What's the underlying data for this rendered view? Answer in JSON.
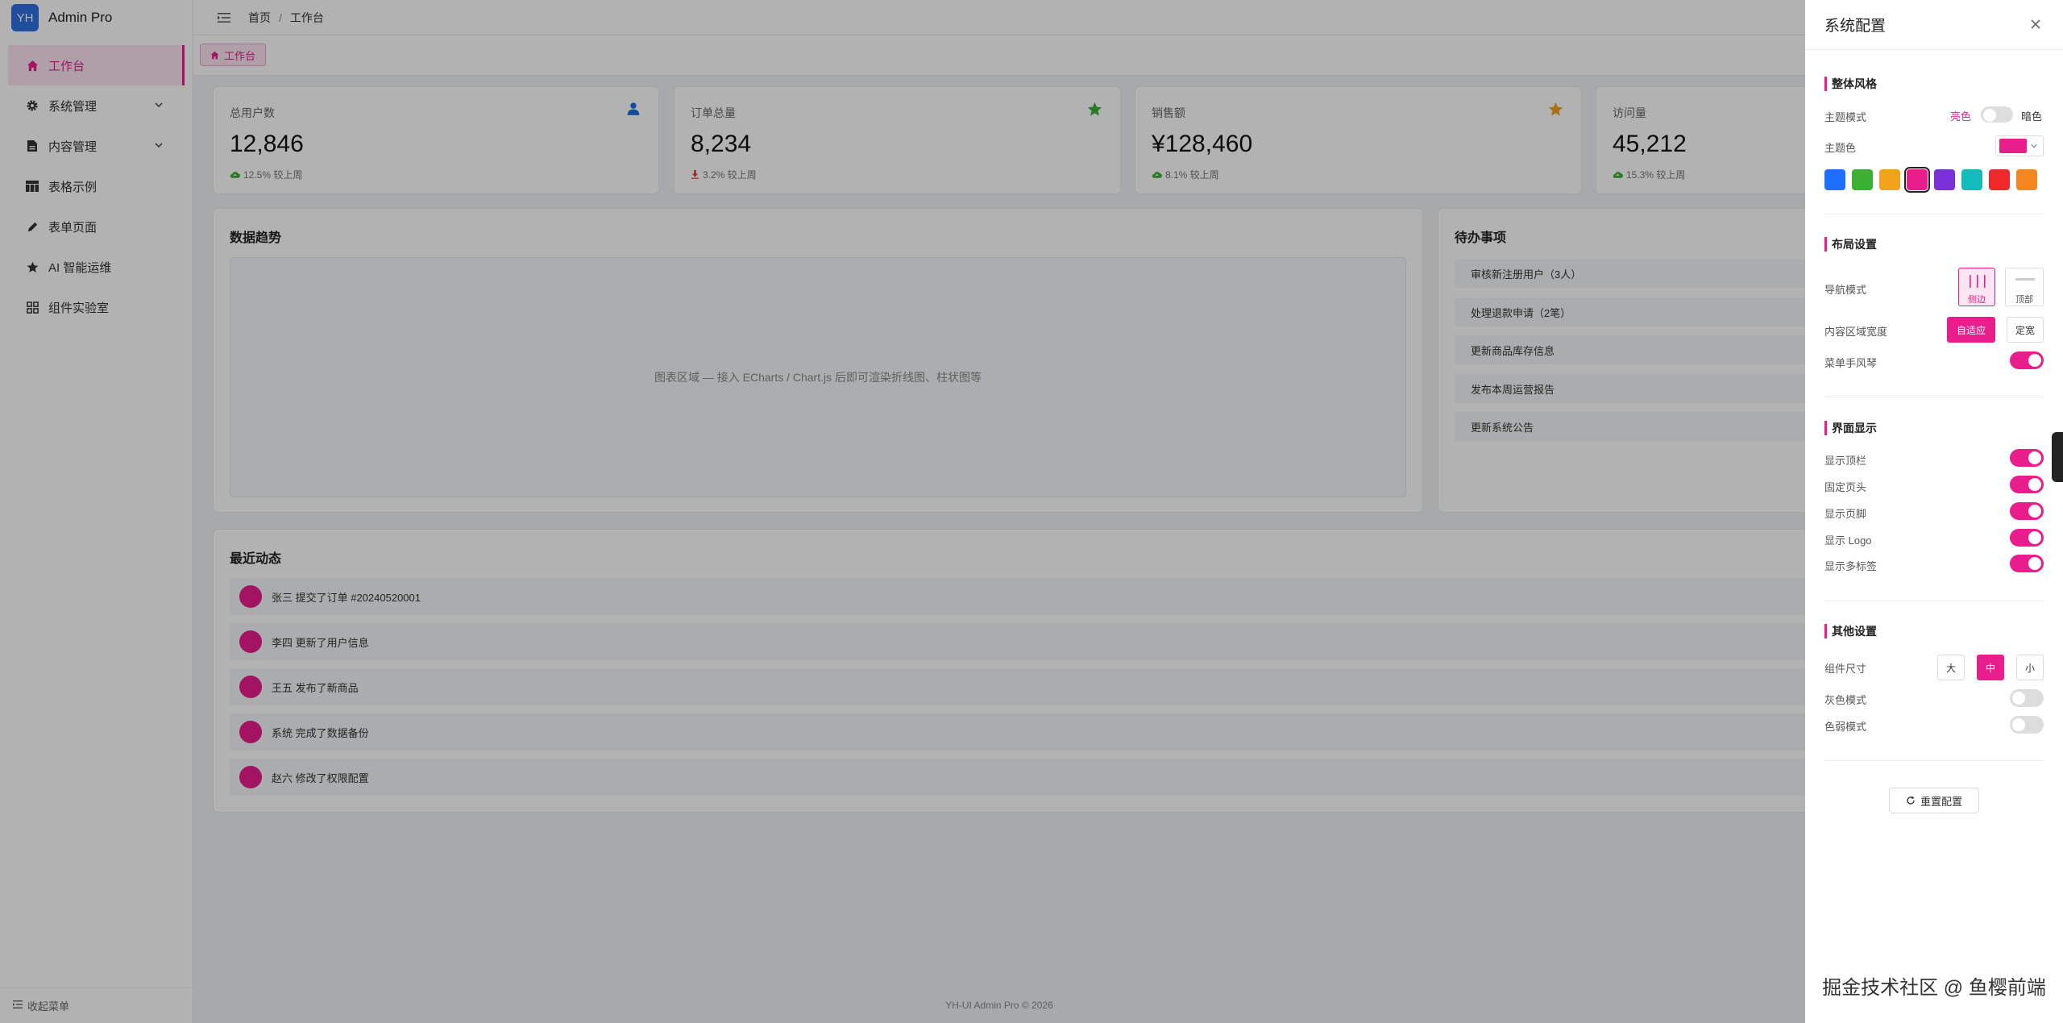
{
  "app": {
    "logo_badge": "YH",
    "name": "Admin Pro"
  },
  "sidebar": {
    "items": [
      {
        "label": "工作台",
        "icon": "home-icon",
        "active": true
      },
      {
        "label": "系统管理",
        "icon": "gear-icon",
        "has_children": true
      },
      {
        "label": "内容管理",
        "icon": "document-icon",
        "has_children": true
      },
      {
        "label": "表格示例",
        "icon": "table-icon"
      },
      {
        "label": "表单页面",
        "icon": "pen-icon"
      },
      {
        "label": "AI 智能运维",
        "icon": "star-icon"
      },
      {
        "label": "组件实验室",
        "icon": "grid-icon"
      }
    ],
    "collapse_label": "收起菜单"
  },
  "header": {
    "breadcrumb": [
      "首页",
      "工作台"
    ]
  },
  "tags": [
    {
      "label": "工作台",
      "active": true
    }
  ],
  "stats": [
    {
      "title": "总用户数",
      "value": "12,846",
      "trend": "12.5% 较上周",
      "direction": "up",
      "icon": "user-icon",
      "icon_color": "#1e6fd9"
    },
    {
      "title": "订单总量",
      "value": "8,234",
      "trend": "3.2% 较上周",
      "direction": "down",
      "icon": "star-icon",
      "icon_color": "#3cb034"
    },
    {
      "title": "销售额",
      "value": "¥128,460",
      "trend": "8.1% 较上周",
      "direction": "up",
      "icon": "star-icon",
      "icon_color": "#f2a31b"
    },
    {
      "title": "访问量",
      "value": "45,212",
      "trend": "15.3% 较上周",
      "direction": "up",
      "icon": "",
      "icon_color": ""
    }
  ],
  "trend_card": {
    "title": "数据趋势",
    "placeholder": "图表区域 — 接入 ECharts / Chart.js 后即可渲染折线图、柱状图等"
  },
  "todo_card": {
    "title": "待办事项",
    "items": [
      "审核新注册用户（3人）",
      "处理退款申请（2笔）",
      "更新商品库存信息",
      "发布本周运营报告",
      "更新系统公告"
    ]
  },
  "activity_card": {
    "title": "最近动态",
    "items": [
      "张三 提交了订单 #20240520001",
      "李四 更新了用户信息",
      "王五 发布了新商品",
      "系统 完成了数据备份",
      "赵六 修改了权限配置"
    ]
  },
  "footer": {
    "text": "YH-UI Admin Pro © 2026"
  },
  "drawer": {
    "title": "系统配置",
    "style_section": {
      "title": "整体风格",
      "theme_mode_label": "主题模式",
      "light_label": "亮色",
      "dark_label": "暗色",
      "dark_enabled": false,
      "theme_color_label": "主题色",
      "current_color": "#e91e8c",
      "swatches": [
        "#1e6fff",
        "#3cb034",
        "#f2a31b",
        "#e91e8c",
        "#7b2fd6",
        "#13bcbc",
        "#f02a2a",
        "#f5861f"
      ]
    },
    "layout_section": {
      "title": "布局设置",
      "nav_mode_label": "导航模式",
      "nav_options": [
        "侧边",
        "顶部"
      ],
      "nav_selected": "侧边",
      "content_width_label": "内容区域宽度",
      "width_options": [
        "自适应",
        "定宽"
      ],
      "width_selected": "自适应",
      "accordion_label": "菜单手风琴",
      "accordion_on": true
    },
    "display_section": {
      "title": "界面显示",
      "items": [
        {
          "label": "显示顶栏",
          "on": true
        },
        {
          "label": "固定页头",
          "on": true
        },
        {
          "label": "显示页脚",
          "on": true
        },
        {
          "label": "显示 Logo",
          "on": true
        },
        {
          "label": "显示多标签",
          "on": true
        }
      ]
    },
    "other_section": {
      "title": "其他设置",
      "size_label": "组件尺寸",
      "size_options": [
        "大",
        "中",
        "小"
      ],
      "size_selected": "中",
      "gray_label": "灰色模式",
      "gray_on": false,
      "weak_label": "色弱模式",
      "weak_on": false
    },
    "reset_label": "重置配置"
  },
  "watermark": "掘金技术社区 @ 鱼樱前端",
  "accent_color": "#e91e8c"
}
